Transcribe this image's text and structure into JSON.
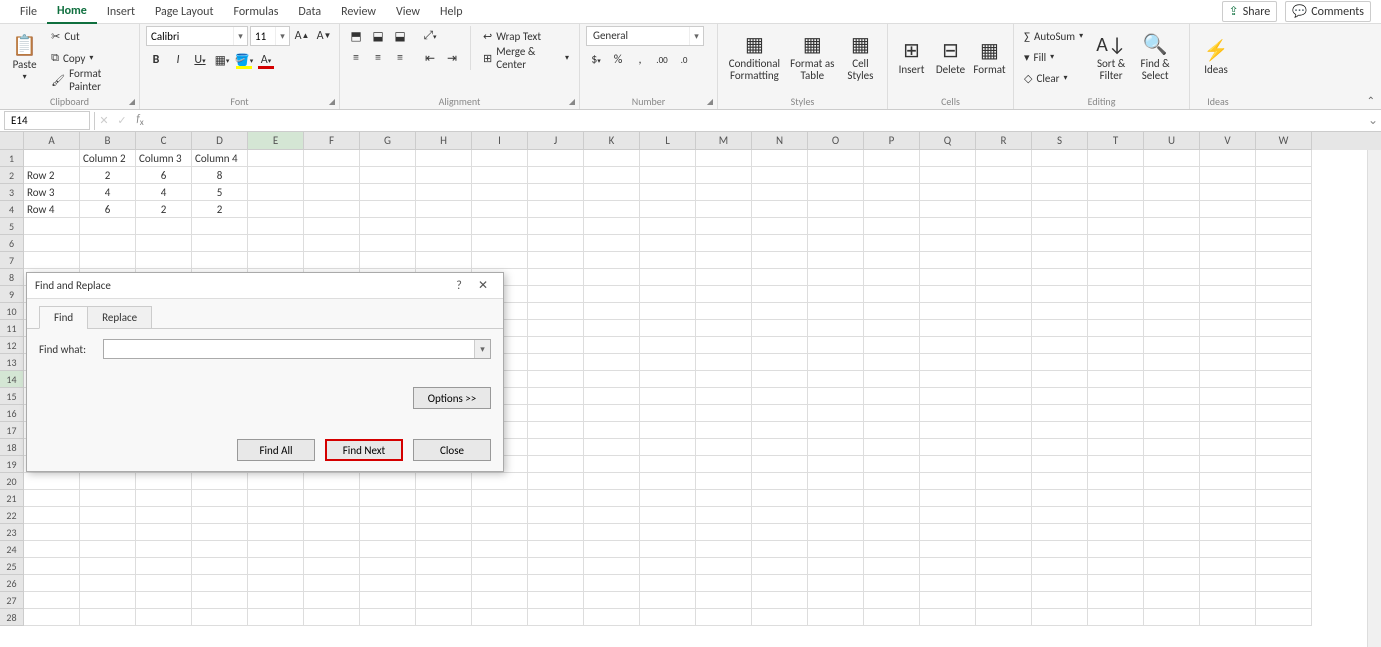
{
  "tabs": [
    "File",
    "Home",
    "Insert",
    "Page Layout",
    "Formulas",
    "Data",
    "Review",
    "View",
    "Help"
  ],
  "active_tab": "Home",
  "share_label": "Share",
  "comments_label": "Comments",
  "clipboard": {
    "paste": "Paste",
    "cut": "Cut",
    "copy": "Copy",
    "fmt": "Format Painter",
    "group": "Clipboard"
  },
  "font": {
    "name": "Calibri",
    "size": "11",
    "group": "Font"
  },
  "alignment": {
    "wrap": "Wrap Text",
    "merge": "Merge & Center",
    "group": "Alignment"
  },
  "number": {
    "fmt": "General",
    "group": "Number"
  },
  "styles": {
    "cond": "Conditional Formatting",
    "tbl": "Format as Table",
    "cell": "Cell Styles",
    "group": "Styles"
  },
  "cells_grp": {
    "insert": "Insert",
    "delete": "Delete",
    "format": "Format",
    "group": "Cells"
  },
  "editing": {
    "autosum": "AutoSum",
    "fill": "Fill",
    "clear": "Clear",
    "sort": "Sort & Filter",
    "find": "Find & Select",
    "group": "Editing"
  },
  "ideas": {
    "label": "Ideas",
    "group": "Ideas"
  },
  "namebox": "E14",
  "columns": [
    "A",
    "B",
    "C",
    "D",
    "E",
    "F",
    "G",
    "H",
    "I",
    "J",
    "K",
    "L",
    "M",
    "N",
    "O",
    "P",
    "Q",
    "R",
    "S",
    "T",
    "U",
    "V",
    "W"
  ],
  "rows_visible": 28,
  "selected_cell": {
    "col": "E",
    "row": 14
  },
  "data_rows": [
    {
      "r": 1,
      "cells": {
        "B": "Column 2",
        "C": "Column 3",
        "D": "Column 4"
      }
    },
    {
      "r": 2,
      "cells": {
        "A": "Row 2",
        "B": "2",
        "C": "6",
        "D": "8"
      }
    },
    {
      "r": 3,
      "cells": {
        "A": "Row 3",
        "B": "4",
        "C": "4",
        "D": "5"
      }
    },
    {
      "r": 4,
      "cells": {
        "A": "Row 4",
        "B": "6",
        "C": "2",
        "D": "2"
      }
    }
  ],
  "dialog": {
    "title": "Find and Replace",
    "tab_find": "Find",
    "tab_replace": "Replace",
    "active_tab": "Find",
    "find_what_label": "Find what:",
    "find_what_value": "",
    "options": "Options >>",
    "find_all": "Find All",
    "find_next": "Find Next",
    "close": "Close"
  }
}
